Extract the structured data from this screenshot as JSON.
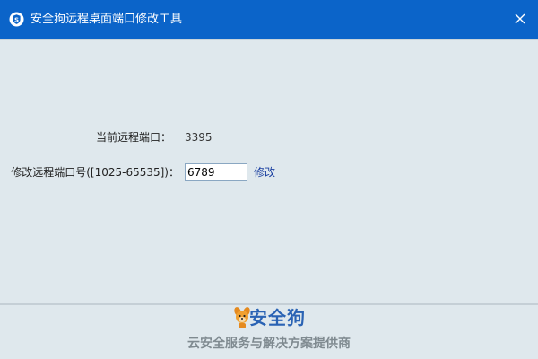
{
  "window": {
    "title": "安全狗远程桌面端口修改工具",
    "close_icon": "close-icon",
    "app_icon": "shield-s-icon"
  },
  "form": {
    "current_port_label": "当前远程端口：",
    "current_port_value": "3395",
    "modify_port_label": "修改远程端口号([1025-65535])：",
    "modify_port_value": "6789",
    "modify_button_label": "修改"
  },
  "footer": {
    "brand_name": "安全狗",
    "tagline": "云安全服务与解决方案提供商",
    "logo_icon": "dog-mascot-icon"
  },
  "colors": {
    "title_bar": "#0b64c9",
    "background": "#dfe8ed",
    "link": "#1a3fa0",
    "brand": "#2a63b4",
    "tagline": "#7f8a90"
  }
}
